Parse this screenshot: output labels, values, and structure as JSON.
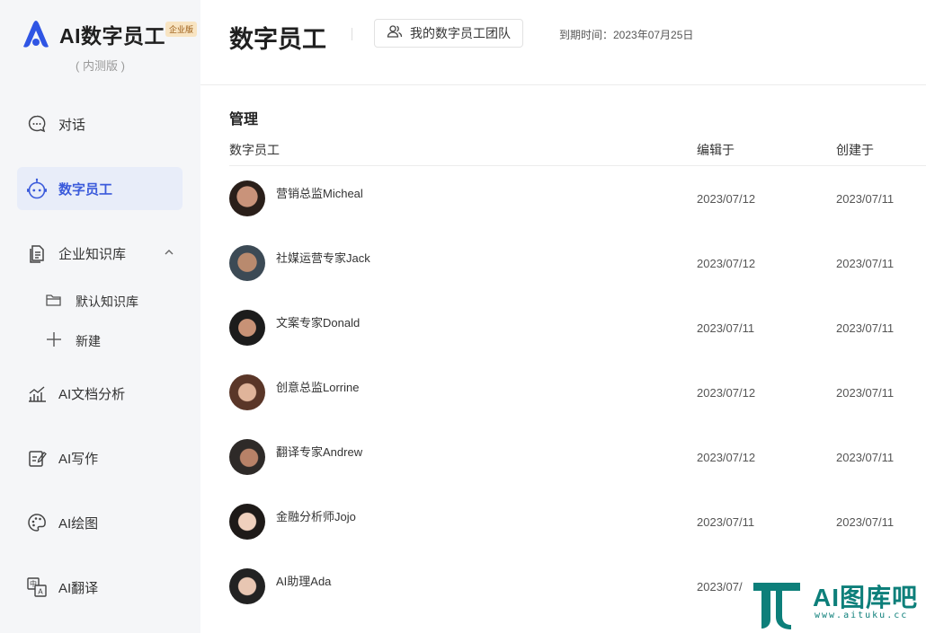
{
  "app": {
    "title": "AI数字员工",
    "badge": "企业版",
    "edition": "( 内测版 )",
    "brand_color": "#3b5bdb"
  },
  "sidebar": {
    "items": [
      {
        "label": "对话",
        "icon": "chat-icon"
      },
      {
        "label": "数字员工",
        "icon": "robot-icon",
        "active": true
      },
      {
        "label": "企业知识库",
        "icon": "document-icon",
        "expanded": true
      },
      {
        "label": "AI文档分析",
        "icon": "chart-icon"
      },
      {
        "label": "AI写作",
        "icon": "edit-icon"
      },
      {
        "label": "AI绘图",
        "icon": "palette-icon"
      },
      {
        "label": "AI翻译",
        "icon": "translate-icon"
      }
    ],
    "knowledge_sub": [
      {
        "label": "默认知识库",
        "icon": "folder-icon"
      },
      {
        "label": "新建",
        "icon": "plus-icon"
      }
    ]
  },
  "header": {
    "title": "数字员工",
    "team_button": "我的数字员工团队",
    "expire": "到期时间：2023年07月25日"
  },
  "main": {
    "section": "管理",
    "columns": {
      "name": "数字员工",
      "edited": "编辑于",
      "created": "创建于"
    },
    "rows": [
      {
        "name": "营销总监Micheal",
        "edited": "2023/07/12",
        "created": "2023/07/11"
      },
      {
        "name": "社媒运营专家Jack",
        "edited": "2023/07/12",
        "created": "2023/07/11"
      },
      {
        "name": "文案专家Donald",
        "edited": "2023/07/11",
        "created": "2023/07/11"
      },
      {
        "name": "创意总监Lorrine",
        "edited": "2023/07/12",
        "created": "2023/07/11"
      },
      {
        "name": "翻译专家Andrew",
        "edited": "2023/07/12",
        "created": "2023/07/11"
      },
      {
        "name": "金融分析师Jojo",
        "edited": "2023/07/11",
        "created": "2023/07/11"
      },
      {
        "name": "AI助理Ada",
        "edited": "2023/07/",
        "created": ""
      }
    ]
  },
  "watermark": {
    "text": "AI图库吧",
    "url": "www.aituku.cc"
  }
}
